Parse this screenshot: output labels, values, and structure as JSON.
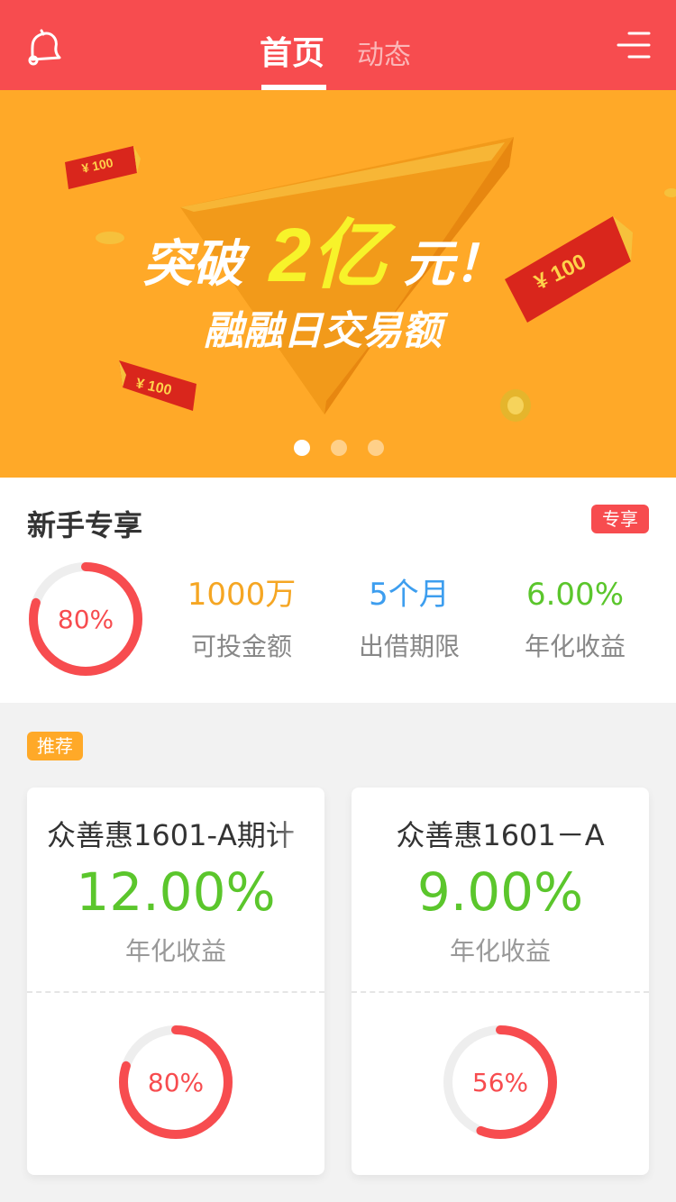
{
  "header": {
    "tab_home": "首页",
    "tab_dynamic": "动态",
    "left_icon": "bell-icon",
    "right_icon": "menu-icon",
    "bg_color": "#f74c4f"
  },
  "banner": {
    "headline_prefix": "突破",
    "headline_highlight": "2亿",
    "headline_suffix": "元！",
    "subtitle": "融融日交易额",
    "coupon_text": "¥ 100",
    "active_slide": 1,
    "slide_count": 3,
    "bg_color": "#ffa928"
  },
  "newbie": {
    "title": "新手专享",
    "badge": "专享",
    "progress_label": "80%",
    "progress": 0.8,
    "stats": [
      {
        "value": "1000万",
        "label": "可投金额",
        "color": "#f5a623"
      },
      {
        "value": "5个月",
        "label": "出借期限",
        "color": "#3d9eef"
      },
      {
        "value": "6.00%",
        "label": "年化收益",
        "color": "#5bc62c"
      }
    ]
  },
  "recommend": {
    "badge": "推荐",
    "cards": [
      {
        "name": "众善惠1601-A期计",
        "rate": "12.00%",
        "rate_label": "年化收益",
        "progress_label": "80%",
        "progress": 0.8
      },
      {
        "name": "众善惠1601－A",
        "rate": "9.00%",
        "rate_label": "年化收益",
        "progress_label": "56%",
        "progress": 0.56
      }
    ]
  }
}
